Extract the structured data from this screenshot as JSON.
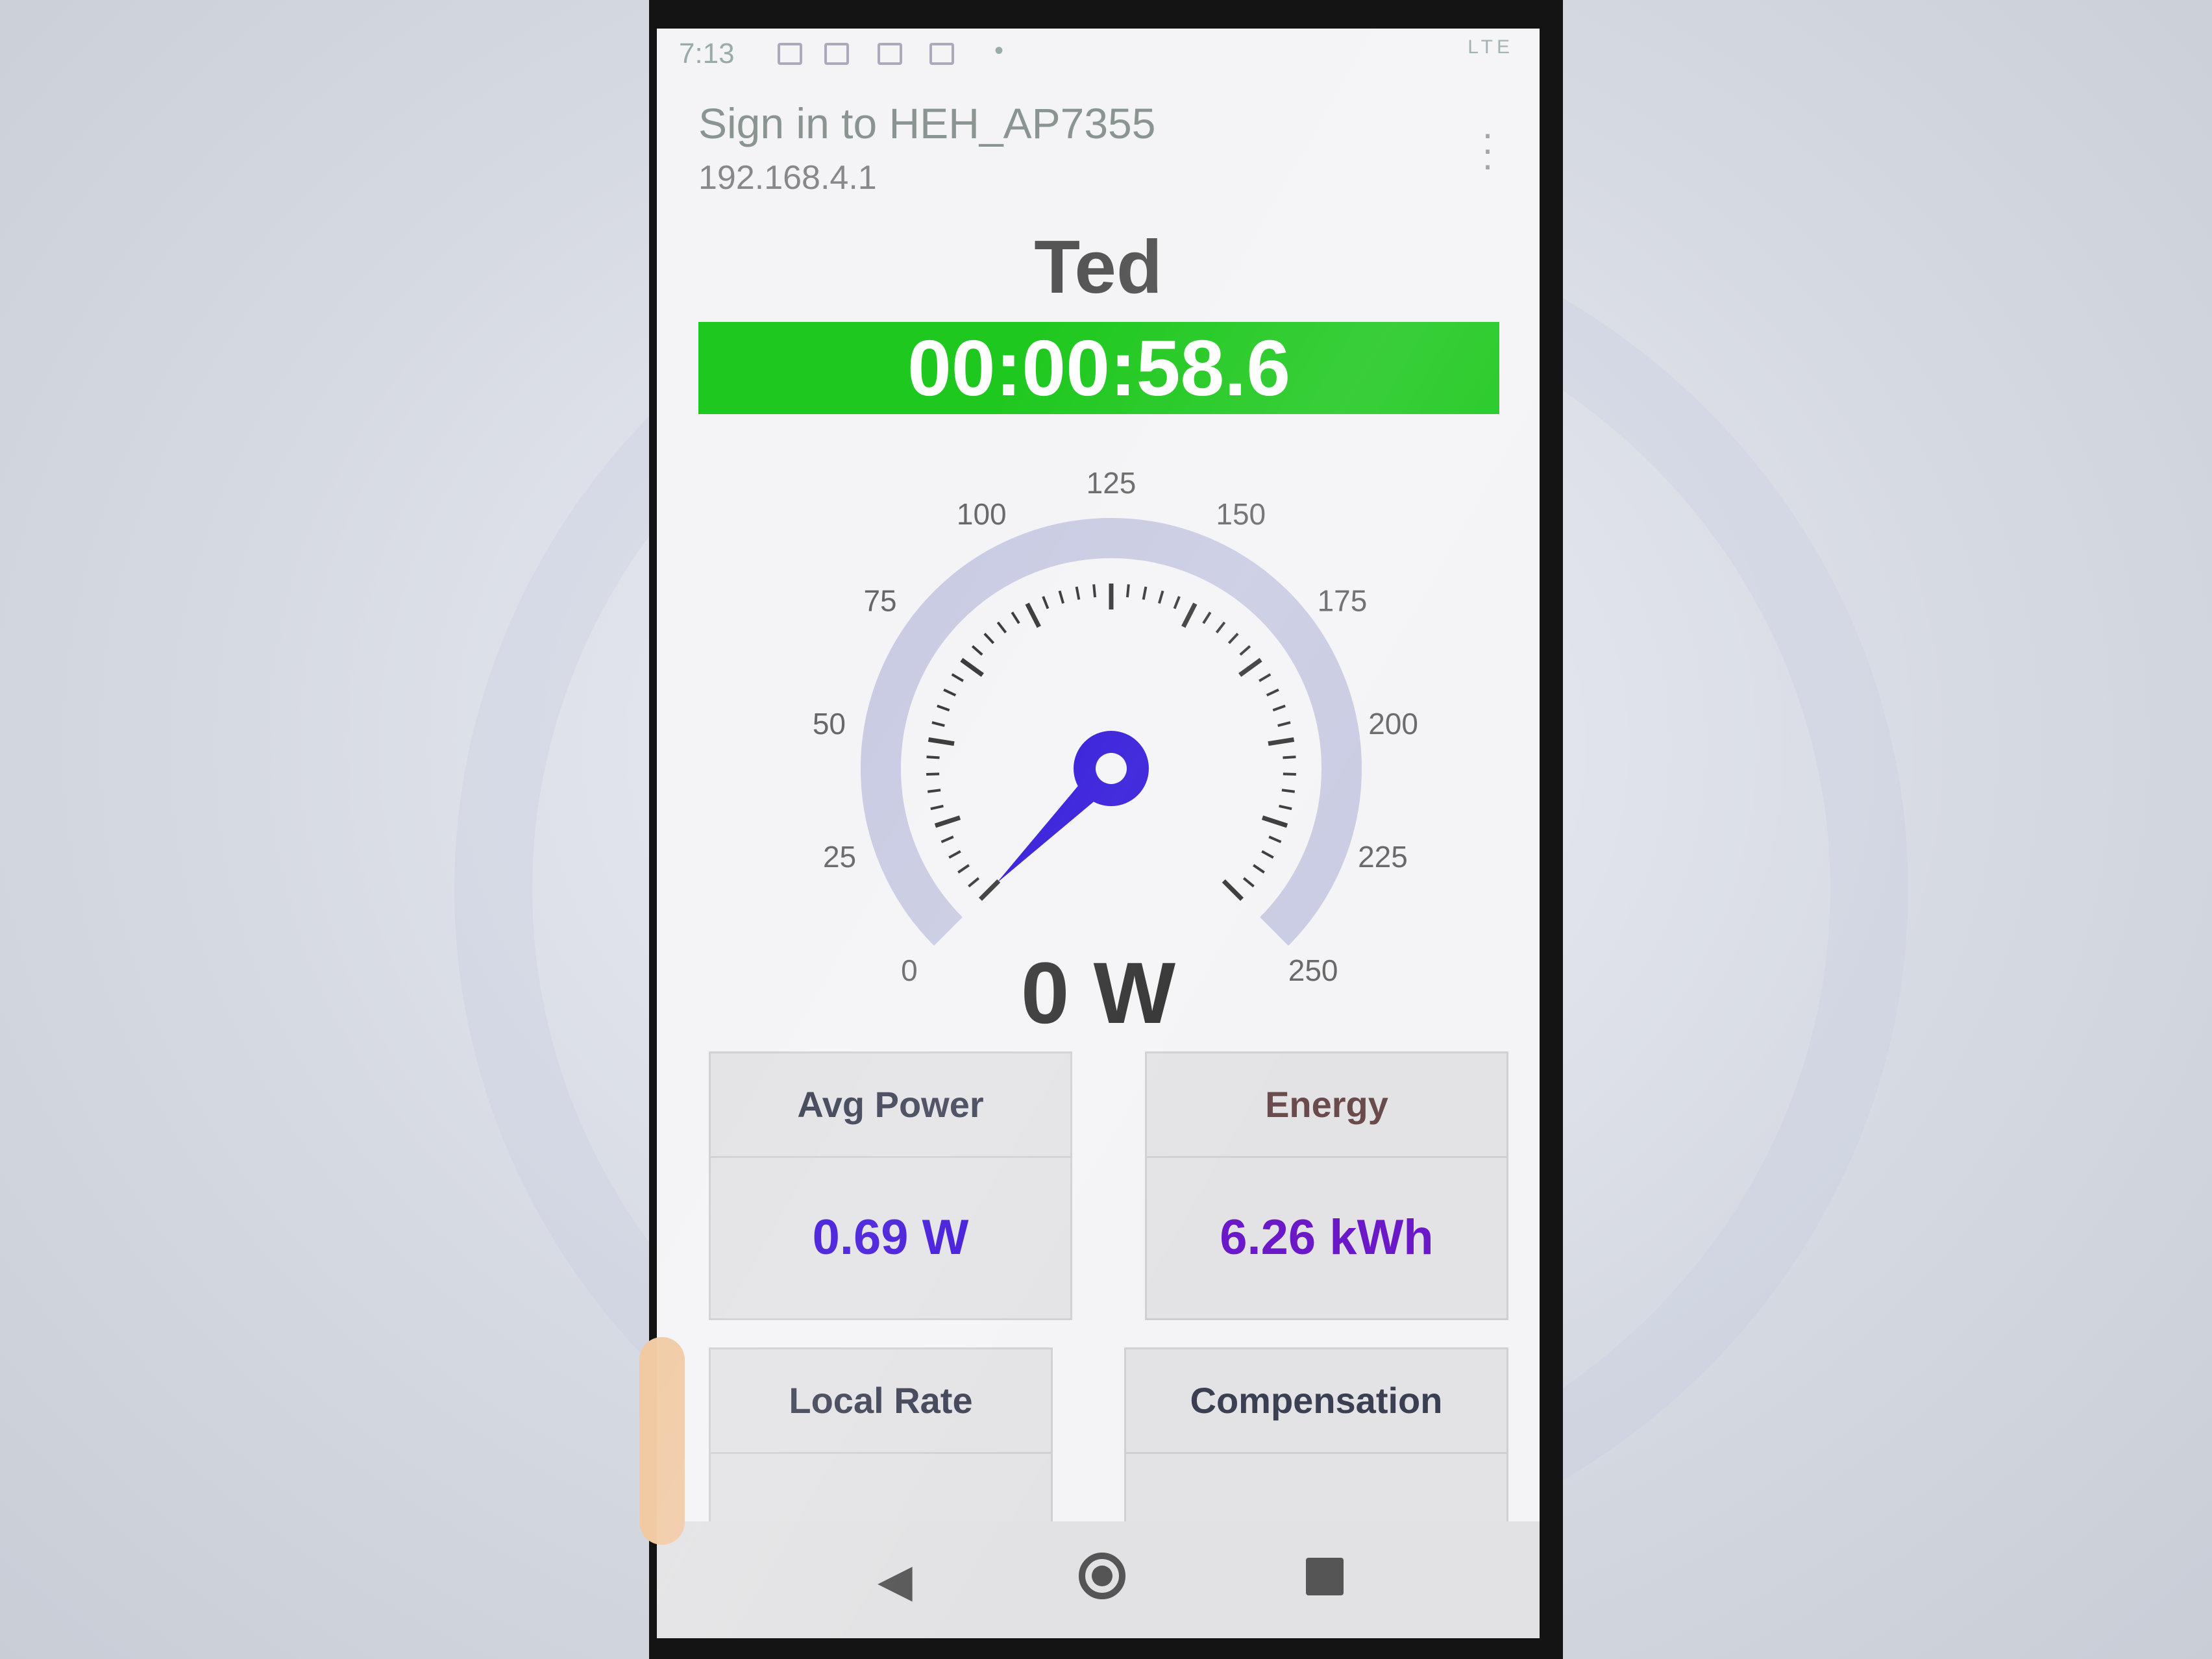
{
  "status_bar": {
    "time": "7:13",
    "network": "LTE"
  },
  "header": {
    "title": "Sign in to HEH_AP7355",
    "url": "192.168.4.1"
  },
  "device_name": "Ted",
  "timer": "00:00:58.6",
  "gauge": {
    "min": 0,
    "max": 250,
    "value": 0,
    "tick_labels": [
      "0",
      "25",
      "50",
      "75",
      "100",
      "125",
      "150",
      "175",
      "200",
      "225",
      "250"
    ]
  },
  "reading": "0 W",
  "cards": [
    {
      "label": "Avg Power",
      "value": "0.69 W"
    },
    {
      "label": "Energy",
      "value": "6.26 kWh"
    },
    {
      "label": "Local Rate",
      "value": ""
    },
    {
      "label": "Compensation",
      "value": ""
    }
  ],
  "colors": {
    "timer_bar": "#1ec81e",
    "needle": "#2a10d8",
    "value_text": "#3c10d8"
  },
  "icons": [
    "menu-icon",
    "back-icon",
    "home-icon",
    "recents-icon"
  ]
}
